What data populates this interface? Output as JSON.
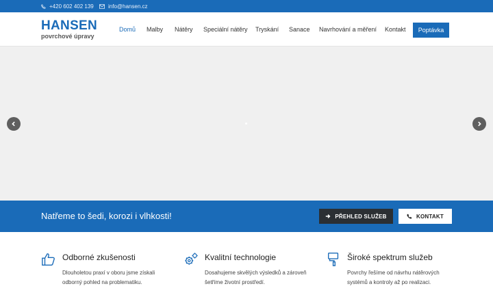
{
  "topbar": {
    "phone": "+420 602 402 139",
    "email": "info@hansen.cz",
    "phone_icon": "phone-icon",
    "email_icon": "envelope-icon"
  },
  "logo": {
    "brand": "HANSEN",
    "tagline": "povrchové úpravy"
  },
  "nav": {
    "items": [
      {
        "label": "Domů",
        "active": true
      },
      {
        "label": "Malby"
      },
      {
        "label": "Nátěry"
      },
      {
        "label": "Speciální nátěry"
      },
      {
        "label": "Tryskání"
      },
      {
        "label": "Sanace"
      },
      {
        "label": "Navrhování a měření"
      },
      {
        "label": "Kontakt"
      }
    ],
    "cta": "Poptávka"
  },
  "slider": {
    "prev_icon": "chevron-left-icon",
    "next_icon": "chevron-right-icon"
  },
  "banner": {
    "headline": "Natřeme to šedi, korozi i vlhkosti!",
    "services_button": "PŘEHLED SLUŽEB",
    "contact_button": "KONTAKT"
  },
  "features": [
    {
      "icon": "thumbs-up-icon",
      "title": "Odborné zkušenosti",
      "description": "Dlouholetou praxí v oboru jsme získali odborný pohled na problematiku."
    },
    {
      "icon": "gears-icon",
      "title": "Kvalitní technologie",
      "description": "Dosahujeme skvělých výsledků a zároveň šetříme životní prostředí."
    },
    {
      "icon": "paint-roller-icon",
      "title": "Široké spektrum služeb",
      "description": "Povrchy řešíme od návrhu nátěrových systémů a kontroly až po realizaci."
    }
  ],
  "colors": {
    "brand_blue": "#1a6bb8",
    "dark_button": "#2b2f33",
    "slider_background": "#f0f0f0"
  }
}
